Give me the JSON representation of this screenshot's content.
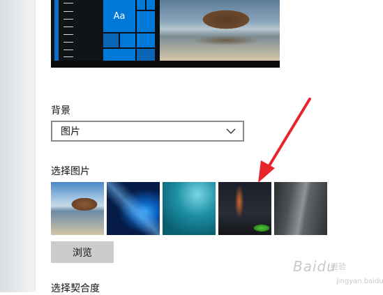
{
  "preview": {
    "tile_label": "Aa"
  },
  "background": {
    "label": "背景",
    "dropdown_value": "图片"
  },
  "choose_picture": {
    "label": "选择图片",
    "thumbnails": [
      "thumbnail-1",
      "thumbnail-2",
      "thumbnail-3",
      "thumbnail-4",
      "thumbnail-5"
    ]
  },
  "browse": {
    "label": "浏览"
  },
  "choose_fit": {
    "label": "选择契合度"
  },
  "watermark": {
    "brand": "Baidu",
    "sub": "经验",
    "url": "jingyan.baidu.com"
  },
  "colors": {
    "accent": "#0078d7",
    "arrow": "#e8232a",
    "button_bg": "#cccccc"
  }
}
